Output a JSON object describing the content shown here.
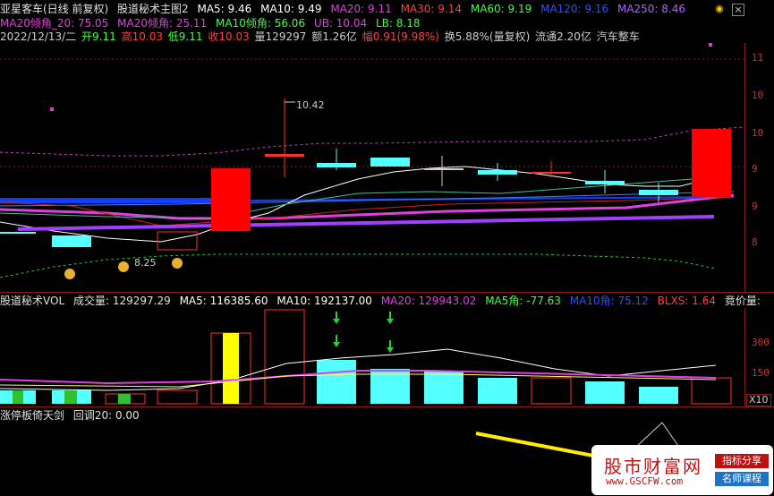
{
  "header": {
    "title": "亚星客车(日线 前复权)",
    "indicator_name": "股道秘术主图2",
    "ma5": "MA5: 9.46",
    "ma10": "MA10: 9.49",
    "ma20": "MA20: 9.11",
    "ma30": "MA30: 9.14",
    "ma60": "MA60: 9.19",
    "ma120": "MA120: 9.16",
    "ma250": "MA250: 8.46"
  },
  "header2": {
    "ma20_slope": "MA20倾角_20: 75.05",
    "ma20_angle": "MA20倾角: 25.11",
    "ma10_angle": "MA10倾角: 56.06",
    "ub": "UB: 10.04",
    "lb": "LB: 8.18"
  },
  "quote": {
    "date": "2022/12/13/二",
    "open": "开9.11",
    "high": "高10.03",
    "low": "低9.11",
    "close": "收10.03",
    "volume": "量129297",
    "amount": "额1.26亿",
    "change": "幅0.91(9.98%)",
    "turnover": "换5.88%(量复权)",
    "float": "流通2.20亿",
    "sector": "汽车整车"
  },
  "chart_labels": {
    "high_label": "10.42",
    "low_label": "8.25"
  },
  "price_axis": [
    "11",
    "10",
    "10",
    "9",
    "9",
    "8"
  ],
  "volume_panel": {
    "name": "股道秘术VOL",
    "cjl": "成交量: 129297.29",
    "ma5": "MA5: 116385.60",
    "ma10": "MA10: 192137.00",
    "ma20": "MA20: 129943.02",
    "ma5_angle": "MA5角: -77.63",
    "ma10_angle": "MA10角: 75.12",
    "blxs": "BLXS: 1.64",
    "auction": "竟价量:",
    "axis": [
      "300",
      "150"
    ],
    "unit": "X10"
  },
  "indicator_panel": {
    "name": "涨停板倚天剑",
    "pullback": "回调20: 0.00"
  },
  "watermark": {
    "title": "股市财富网",
    "url": "www.GSCFW.com",
    "tag1": "指标分享",
    "tag2": "名师课程"
  },
  "colors": {
    "up": "#ff0000",
    "down": "#54ffff",
    "ma5": "#ffffff",
    "ma20": "#d040d0",
    "ma60": "#1060ff",
    "ma250": "#a040ff"
  }
}
